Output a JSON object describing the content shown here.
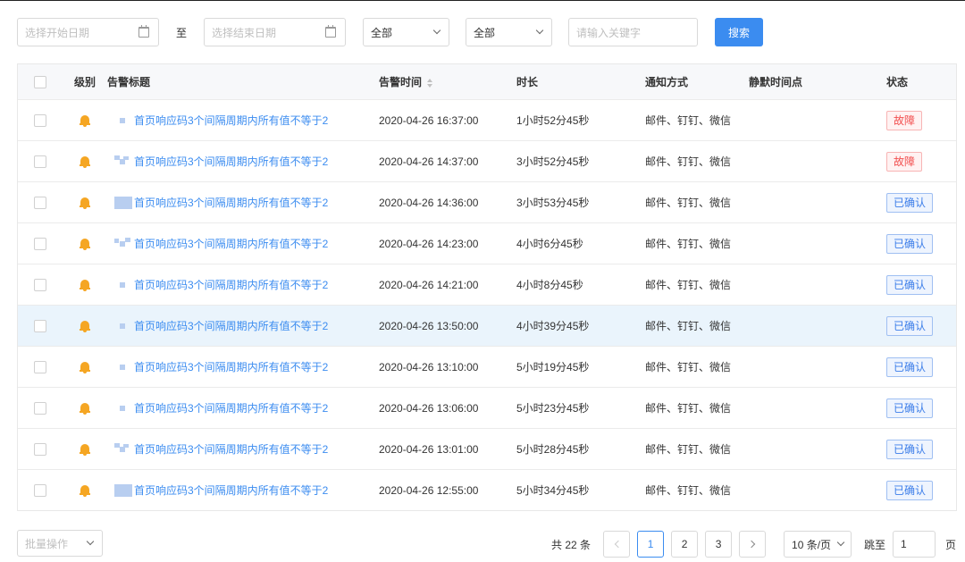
{
  "filters": {
    "start_date_placeholder": "选择开始日期",
    "to_label": "至",
    "end_date_placeholder": "选择结束日期",
    "level_select": "全部",
    "status_select": "全部",
    "keyword_placeholder": "请输入关键字",
    "search_label": "搜索"
  },
  "table": {
    "headers": {
      "level": "级别",
      "title": "告警标题",
      "time": "告警时间",
      "duration": "时长",
      "notify": "通知方式",
      "silent": "静默时间点",
      "status": "状态"
    },
    "rows": [
      {
        "title": "首页响应码3个间隔周期内所有值不等于2",
        "time": "2020-04-26 16:37:00",
        "duration": "1小时52分45秒",
        "notify": "邮件、钉钉、微信",
        "status": "故障"
      },
      {
        "title": "首页响应码3个间隔周期内所有值不等于2",
        "time": "2020-04-26 14:37:00",
        "duration": "3小时52分45秒",
        "notify": "邮件、钉钉、微信",
        "status": "故障"
      },
      {
        "title": "首页响应码3个间隔周期内所有值不等于2",
        "time": "2020-04-26 14:36:00",
        "duration": "3小时53分45秒",
        "notify": "邮件、钉钉、微信",
        "status": "已确认"
      },
      {
        "title": "首页响应码3个间隔周期内所有值不等于2",
        "time": "2020-04-26 14:23:00",
        "duration": "4小时6分45秒",
        "notify": "邮件、钉钉、微信",
        "status": "已确认"
      },
      {
        "title": "首页响应码3个间隔周期内所有值不等于2",
        "time": "2020-04-26 14:21:00",
        "duration": "4小时8分45秒",
        "notify": "邮件、钉钉、微信",
        "status": "已确认"
      },
      {
        "title": "首页响应码3个间隔周期内所有值不等于2",
        "time": "2020-04-26 13:50:00",
        "duration": "4小时39分45秒",
        "notify": "邮件、钉钉、微信",
        "status": "已确认"
      },
      {
        "title": "首页响应码3个间隔周期内所有值不等于2",
        "time": "2020-04-26 13:10:00",
        "duration": "5小时19分45秒",
        "notify": "邮件、钉钉、微信",
        "status": "已确认"
      },
      {
        "title": "首页响应码3个间隔周期内所有值不等于2",
        "time": "2020-04-26 13:06:00",
        "duration": "5小时23分45秒",
        "notify": "邮件、钉钉、微信",
        "status": "已确认"
      },
      {
        "title": "首页响应码3个间隔周期内所有值不等于2",
        "time": "2020-04-26 13:01:00",
        "duration": "5小时28分45秒",
        "notify": "邮件、钉钉、微信",
        "status": "已确认"
      },
      {
        "title": "首页响应码3个间隔周期内所有值不等于2",
        "time": "2020-04-26 12:55:00",
        "duration": "5小时34分45秒",
        "notify": "邮件、钉钉、微信",
        "status": "已确认"
      }
    ]
  },
  "footer": {
    "batch_label": "批量操作",
    "total": "共 22 条",
    "pages": [
      "1",
      "2",
      "3"
    ],
    "current_page": "1",
    "page_size": "10 条/页",
    "jump_label": "跳至",
    "jump_value": "1",
    "page_unit": "页"
  },
  "colors": {
    "primary": "#3b8cf0",
    "fault": "#f24e4e",
    "ack": "#3b7de9",
    "bell": "#f5a623",
    "highlight_row": "#eaf4fc"
  }
}
